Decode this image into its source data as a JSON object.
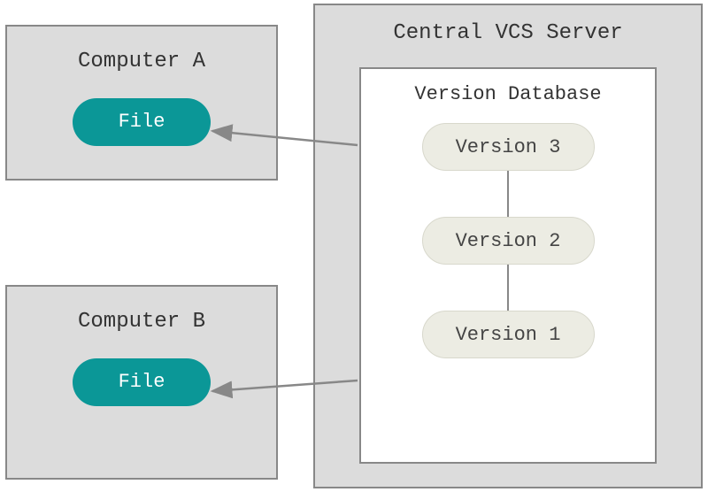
{
  "server": {
    "title": "Central VCS Server",
    "database": {
      "title": "Version Database",
      "versions": [
        "Version 3",
        "Version 2",
        "Version 1"
      ]
    }
  },
  "computerA": {
    "title": "Computer A",
    "file_label": "File"
  },
  "computerB": {
    "title": "Computer B",
    "file_label": "File"
  }
}
